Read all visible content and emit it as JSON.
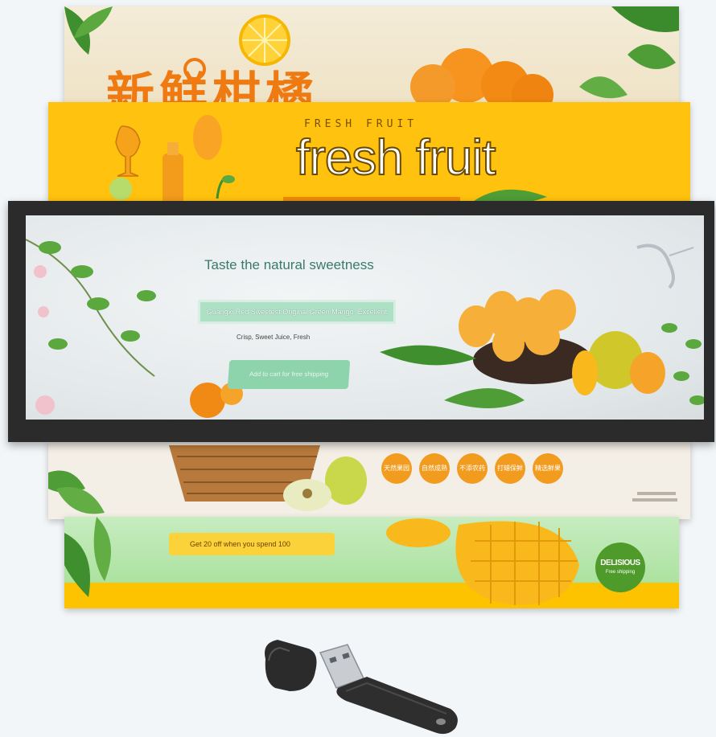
{
  "banner_oranges": {
    "title_cn": "新鲜柑橘"
  },
  "banner_fresh": {
    "subtitle": "FRESH FRUIT",
    "title": "fresh fruit"
  },
  "display": {
    "tagline": "Taste the natural sweetness",
    "description": "Guangxi Red Sweetest Original Green Mango, Excellent",
    "features": "Crisp, Sweet Juice, Fresh",
    "cta": "Add to cart for free shipping"
  },
  "banner_basket": {
    "icons": [
      "天然果园",
      "自然成熟",
      "不添农药",
      "打蜡保鲜",
      "精选鲜果"
    ]
  },
  "banner_mango": {
    "promo": "Get 20 off when you spend 100",
    "brand": "DELISIOUS",
    "brand_sub": "Free shipping"
  },
  "colors": {
    "orange": "#f07a12",
    "yellow": "#ffc20e",
    "frame": "#2b2b2b",
    "mint": "#8dd3ac",
    "green": "#4e9a2a"
  }
}
